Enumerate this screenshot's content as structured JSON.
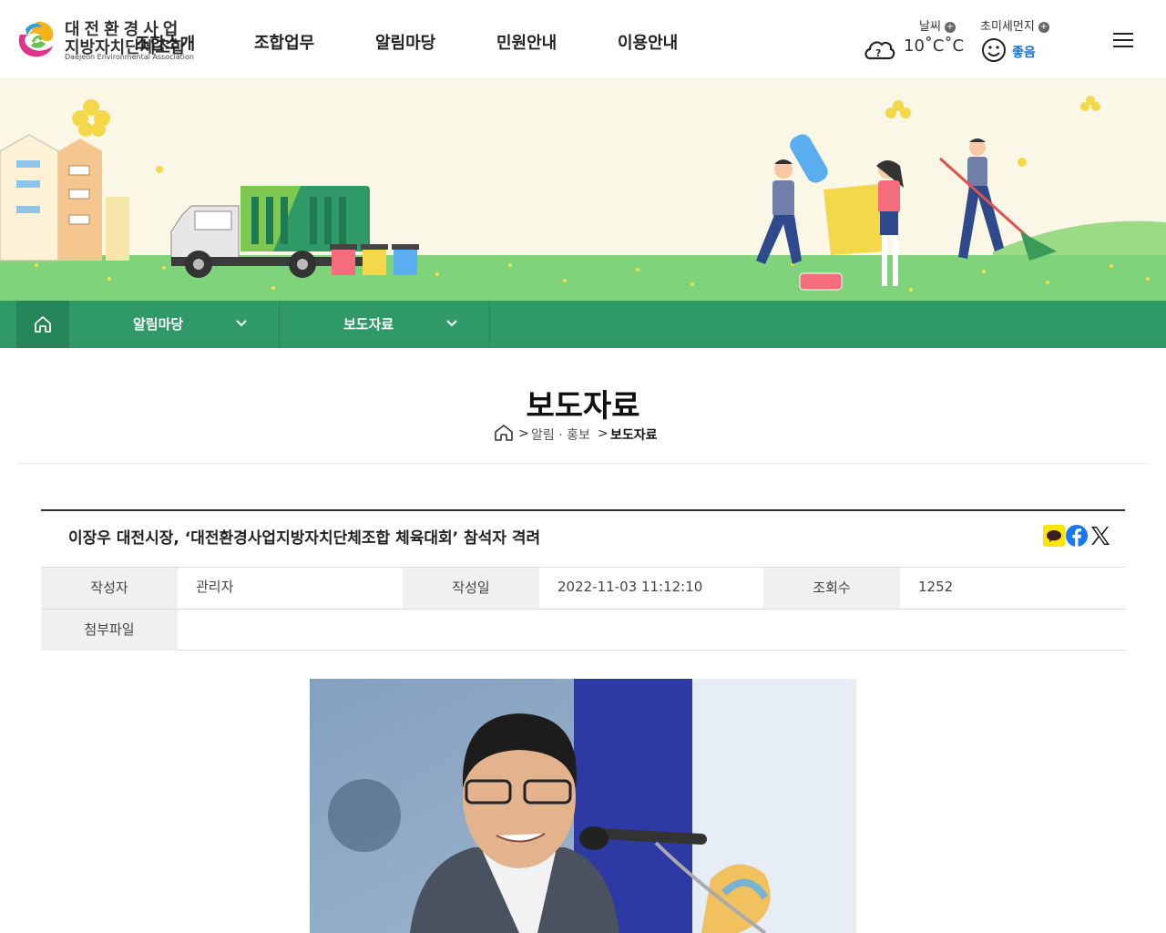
{
  "header": {
    "logo_line1": "대전환경사업",
    "logo_line2": "지방자치단체조합",
    "logo_line3": "Daejeon Environmental Association",
    "overlap_menu": "조합소개",
    "menu": [
      "조합업무",
      "알림마당",
      "민원안내",
      "이용안내"
    ],
    "weather_label": "날씨",
    "temperature": "10˚C˚C",
    "dust_label": "초미세먼지",
    "dust_status": "좋음",
    "plus": "+",
    "icons": {
      "weather": "cloud-question-icon",
      "dust": "smile-face-icon",
      "menu": "hamburger-menu-icon"
    }
  },
  "subnav": {
    "level1": "알림마당",
    "level2": "보도자료",
    "icons": {
      "home": "home-icon",
      "expand": "chevron-down-icon"
    }
  },
  "page": {
    "title": "보도자료",
    "breadcrumb": [
      "알림 · 홍보",
      "보도자료"
    ],
    "breadcrumb_sep": ">"
  },
  "article": {
    "title": "이장우 대전시장, ‘대전환경사업지방자치단체조합 체육대회’ 참석자 격려",
    "author_label": "작성자",
    "author": "관리자",
    "date_label": "작성일",
    "date": "2022-11-03 11:12:10",
    "views_label": "조회수",
    "views": "1252",
    "attachment_label": "첨부파일",
    "attachment": "",
    "share_icons": [
      "kakaotalk-icon",
      "facebook-icon",
      "x-twitter-icon"
    ]
  },
  "colors": {
    "green": "#2f9a68",
    "green_dark": "#268558",
    "banner_bg": "#fbf7e6",
    "grass": "#7fd37a",
    "dust_good": "#1e6fd9"
  }
}
